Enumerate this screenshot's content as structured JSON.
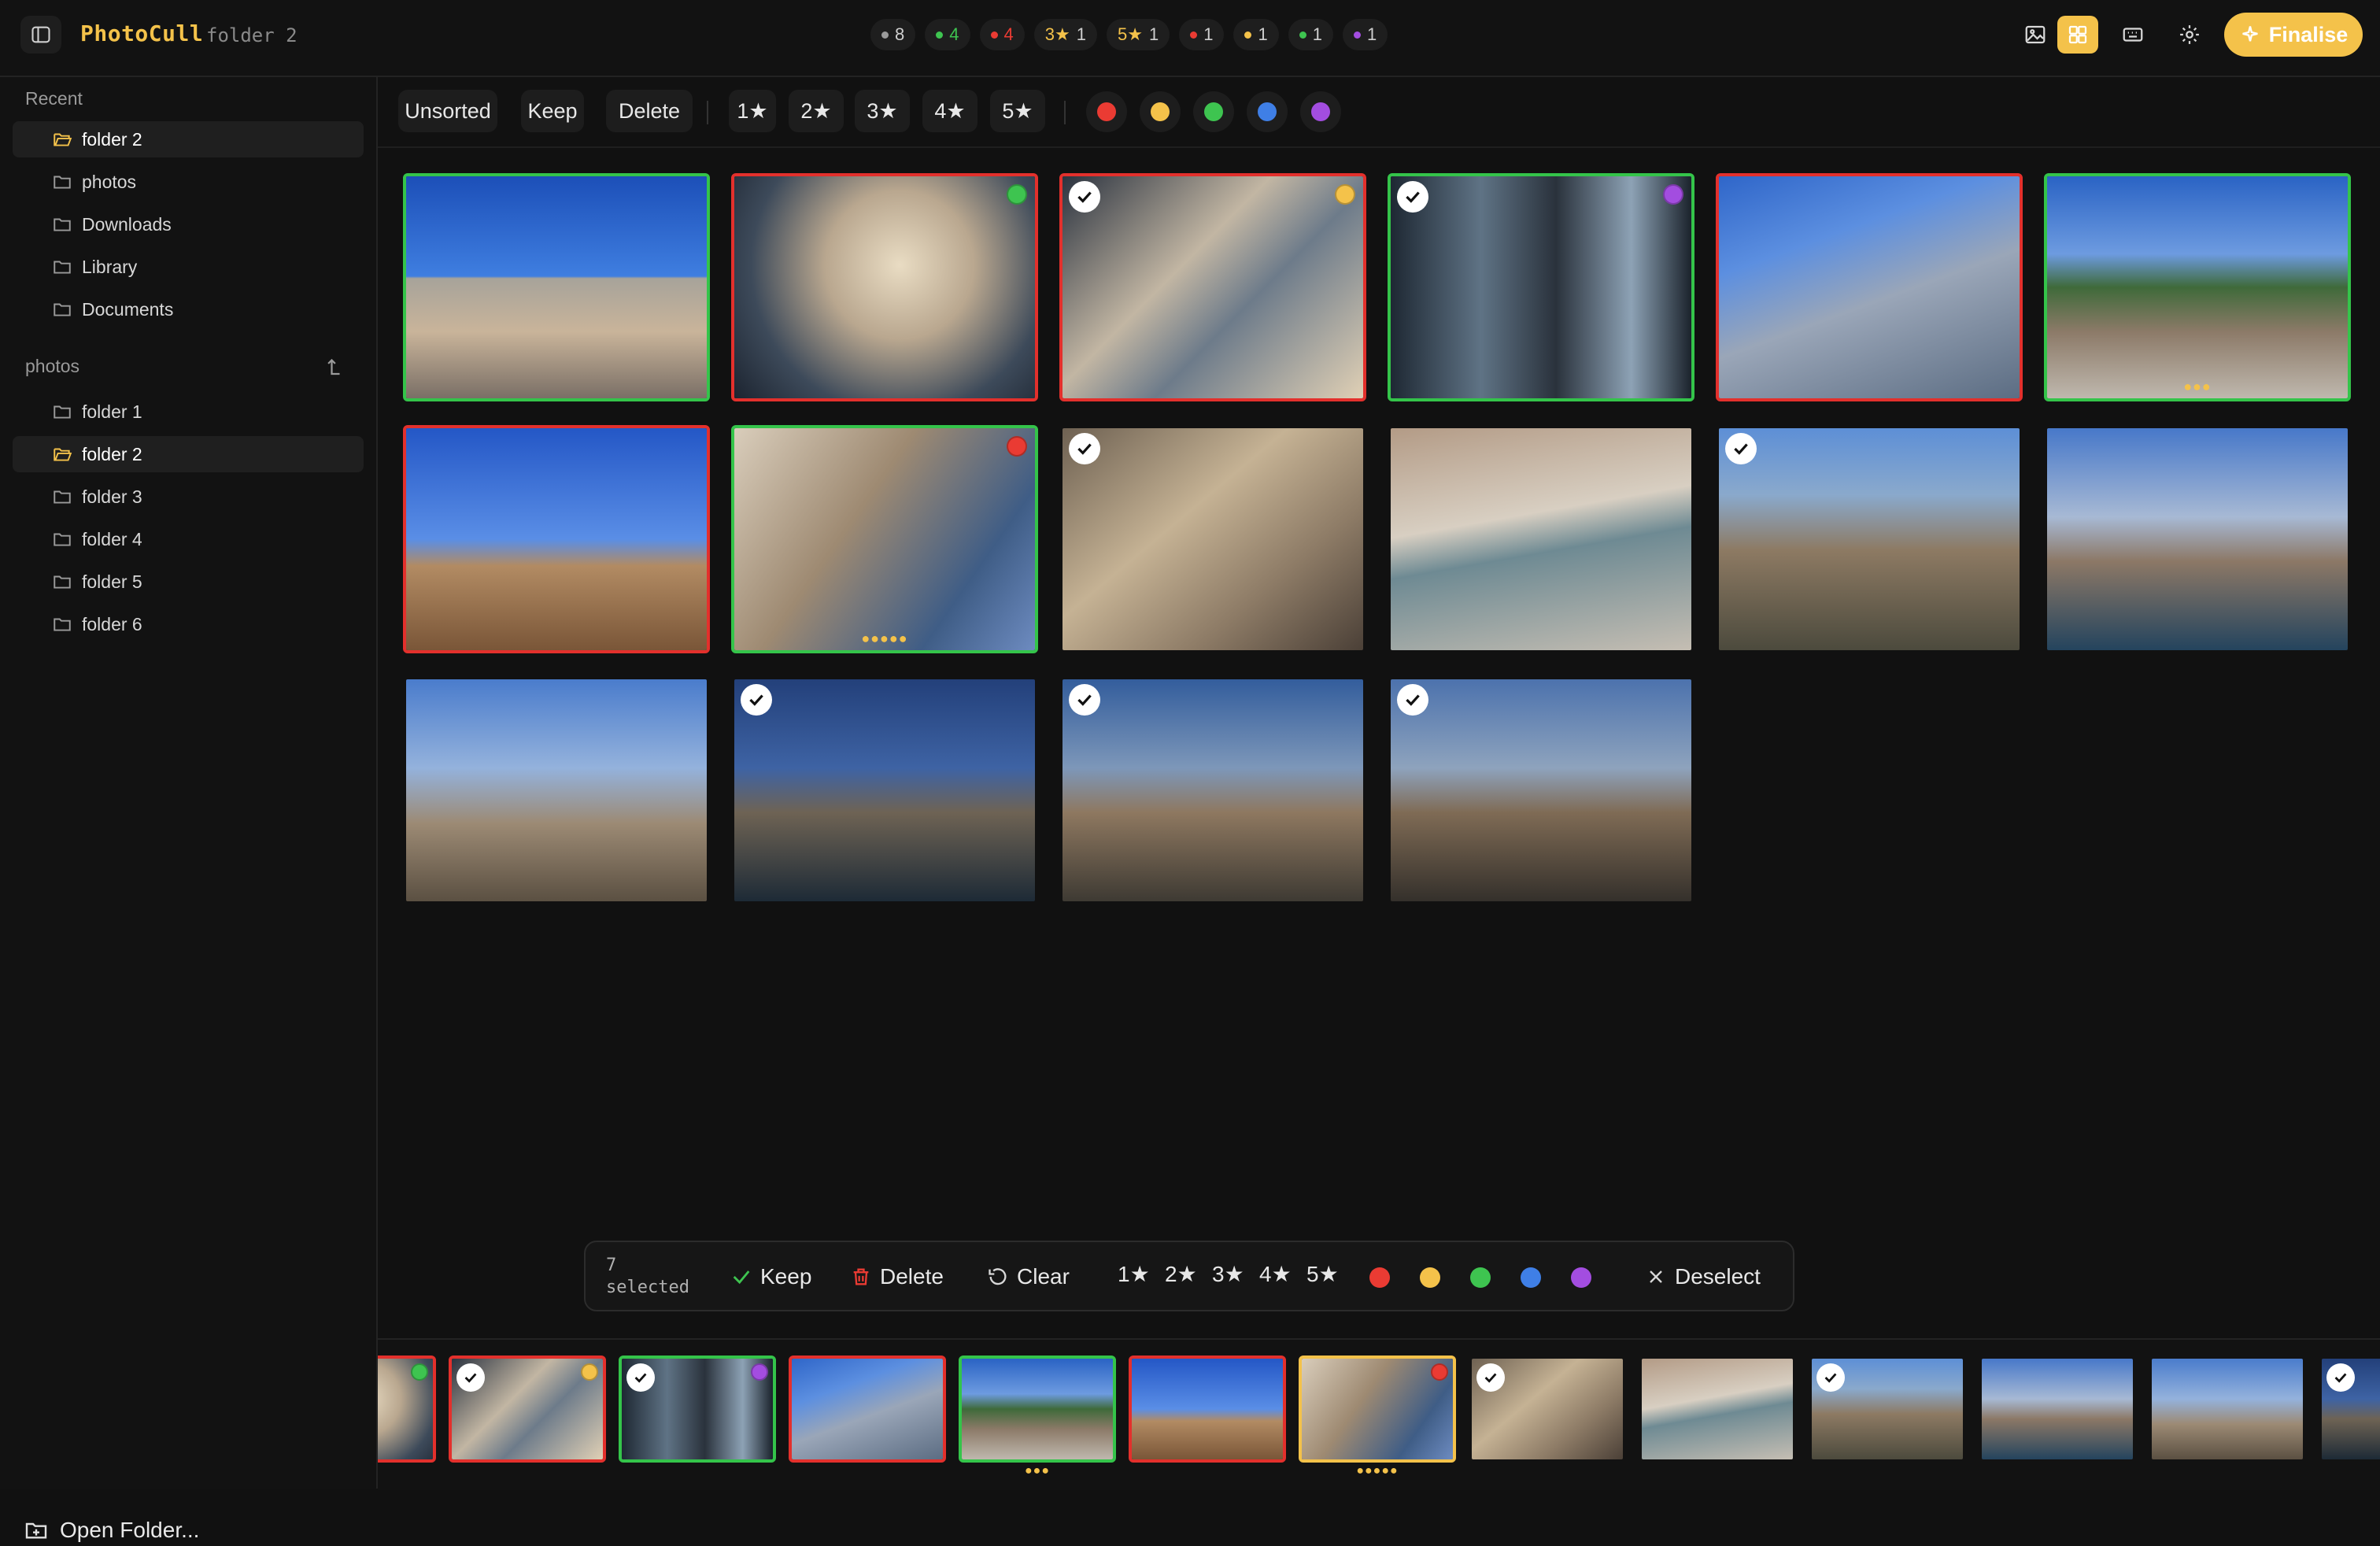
{
  "app": {
    "name": "PhotoCull",
    "folder": "folder 2"
  },
  "status_chips": [
    {
      "dot": "#9a9a9a",
      "count": "8"
    },
    {
      "dot": "#3ec450",
      "count": "4",
      "count_style": "green"
    },
    {
      "dot": "#ea3b33",
      "count": "4",
      "count_style": "red"
    },
    {
      "label": "3★",
      "count": "1"
    },
    {
      "label": "5★",
      "count": "1"
    },
    {
      "dot": "#ea3b33",
      "count": "1"
    },
    {
      "dot": "#f4c24a",
      "count": "1"
    },
    {
      "dot": "#3ec450",
      "count": "1"
    },
    {
      "dot": "#a34de0",
      "count": "1"
    }
  ],
  "toolbar": {
    "finalise_label": "Finalise"
  },
  "sidebar": {
    "recent_heading": "Recent",
    "recent": [
      "folder 2",
      "photos",
      "Downloads",
      "Library",
      "Documents"
    ],
    "tree_heading": "photos",
    "tree": [
      "folder 1",
      "folder 2",
      "folder 3",
      "folder 4",
      "folder 5",
      "folder 6"
    ],
    "open_folder_label": "Open Folder..."
  },
  "filters": {
    "status": [
      "Unsorted",
      "Keep",
      "Delete"
    ],
    "ratings": [
      "1★",
      "2★",
      "3★",
      "4★",
      "5★"
    ],
    "colors": [
      "#ea3b33",
      "#f4c24a",
      "#3ec450",
      "#3f7fe6",
      "#a34de0"
    ]
  },
  "grid": [
    {
      "border": "green",
      "checked": false,
      "tag": null,
      "stars": "",
      "texture": "p-sky1"
    },
    {
      "border": "red",
      "checked": false,
      "tag": "#3ec450",
      "stars": "",
      "texture": "p-int1"
    },
    {
      "border": "red",
      "checked": true,
      "tag": "#f4c24a",
      "stars": "",
      "texture": "p-int2"
    },
    {
      "border": "green",
      "checked": true,
      "tag": "#a34de0",
      "stars": "",
      "texture": "p-int3"
    },
    {
      "border": "red",
      "checked": false,
      "tag": null,
      "stars": "",
      "texture": "p-wall"
    },
    {
      "border": "green",
      "checked": false,
      "tag": null,
      "stars": "●●●",
      "texture": "p-bridge"
    },
    {
      "border": "red",
      "checked": false,
      "tag": null,
      "stars": "",
      "texture": "p-sky2"
    },
    {
      "border": "green",
      "checked": false,
      "tag": "#ea3b33",
      "stars": "●●●●●",
      "texture": "p-metal"
    },
    {
      "border": "none",
      "checked": true,
      "tag": null,
      "stars": "",
      "texture": "p-metal2"
    },
    {
      "border": "none",
      "checked": false,
      "tag": null,
      "stars": "",
      "texture": "p-river"
    },
    {
      "border": "none",
      "checked": true,
      "tag": null,
      "stars": "",
      "texture": "p-aerial"
    },
    {
      "border": "none",
      "checked": false,
      "tag": null,
      "stars": "",
      "texture": "p-river2"
    },
    {
      "border": "none",
      "checked": false,
      "tag": null,
      "stars": "",
      "texture": "p-tower"
    },
    {
      "border": "none",
      "checked": true,
      "tag": null,
      "stars": "",
      "texture": "p-night"
    },
    {
      "border": "none",
      "checked": true,
      "tag": null,
      "stars": "",
      "texture": "p-dusk"
    },
    {
      "border": "none",
      "checked": true,
      "tag": null,
      "stars": "",
      "texture": "p-dusk2"
    }
  ],
  "selection_bar": {
    "count": "7",
    "count_suffix": "selected",
    "keep": "Keep",
    "delete": "Delete",
    "clear": "Clear",
    "ratings": [
      "1★",
      "2★",
      "3★",
      "4★",
      "5★"
    ],
    "colors": [
      "#ea3b33",
      "#f4c24a",
      "#3ec450",
      "#3f7fe6",
      "#a34de0"
    ],
    "deselect": "Deselect"
  },
  "filmstrip": [
    {
      "border": "red",
      "checked": false,
      "tag": "#3ec450",
      "stars": "",
      "texture": "p-int1"
    },
    {
      "border": "red",
      "checked": true,
      "tag": "#f4c24a",
      "stars": "",
      "texture": "p-int2"
    },
    {
      "border": "green",
      "checked": true,
      "tag": "#a34de0",
      "stars": "",
      "texture": "p-int3"
    },
    {
      "border": "red",
      "checked": false,
      "tag": null,
      "stars": "",
      "texture": "p-wall"
    },
    {
      "border": "green",
      "checked": false,
      "tag": null,
      "stars": "●●●",
      "texture": "p-bridge"
    },
    {
      "border": "red",
      "checked": false,
      "tag": null,
      "stars": "",
      "texture": "p-sky2"
    },
    {
      "border": "yellow",
      "checked": false,
      "tag": "#ea3b33",
      "stars": "●●●●●",
      "texture": "p-metal"
    },
    {
      "border": "none",
      "checked": true,
      "tag": null,
      "stars": "",
      "texture": "p-metal2"
    },
    {
      "border": "none",
      "checked": false,
      "tag": null,
      "stars": "",
      "texture": "p-river"
    },
    {
      "border": "none",
      "checked": true,
      "tag": null,
      "stars": "",
      "texture": "p-aerial"
    },
    {
      "border": "none",
      "checked": false,
      "tag": null,
      "stars": "",
      "texture": "p-river2"
    },
    {
      "border": "none",
      "checked": false,
      "tag": null,
      "stars": "",
      "texture": "p-tower"
    },
    {
      "border": "none",
      "checked": true,
      "tag": null,
      "stars": "",
      "texture": "p-night"
    }
  ]
}
